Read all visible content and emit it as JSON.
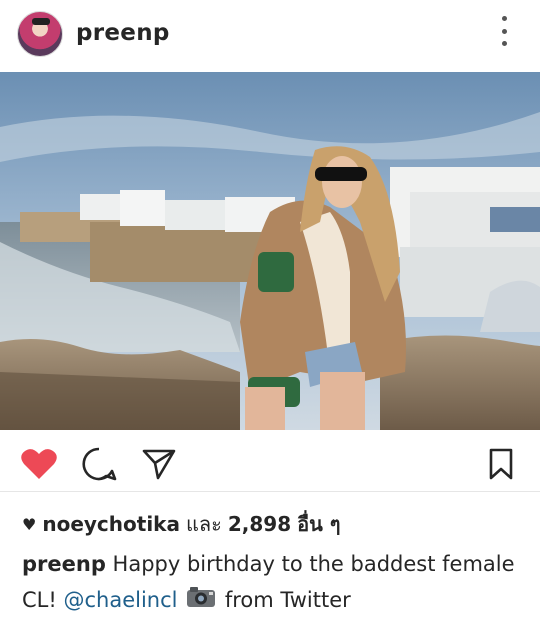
{
  "post": {
    "username": "preenp",
    "likes": {
      "liker": "noeychotika",
      "connector": "และ",
      "count": "2,898",
      "suffix": "อื่น ๆ"
    },
    "caption": {
      "user": "preenp",
      "text_before": "Happy birthday to the baddest female CL!",
      "mention": "@chaelincl",
      "text_after": "from Twitter"
    }
  },
  "icons": {
    "more": "more-options-icon",
    "like": "heart-icon",
    "comment": "comment-icon",
    "share": "share-icon",
    "save": "bookmark-icon",
    "camera": "camera-emoji-icon"
  },
  "colors": {
    "like_red": "#ed4956",
    "mention_blue": "#1f5f8b",
    "text": "#262626"
  }
}
